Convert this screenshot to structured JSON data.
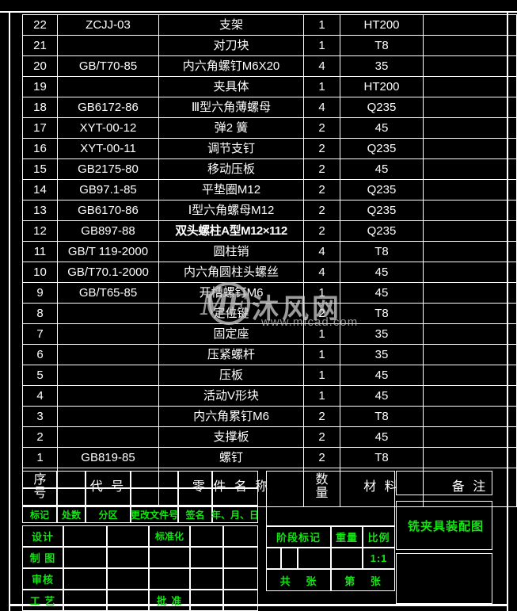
{
  "document": {
    "kind": "cad-assembly-drawing",
    "title": "铣夹具装配图"
  },
  "bom": {
    "columns": {
      "no": "序号",
      "no_line1": "序",
      "no_line2": "号",
      "code": "代    号",
      "name": "零 件 名 称",
      "qty": "数量",
      "qty_line1": "数",
      "qty_line2": "量",
      "material": "材    料",
      "remark": "备    注"
    },
    "rows": [
      {
        "no": "22",
        "code": "ZCJJ-03",
        "name": "支架",
        "qty": "1",
        "material": "HT200",
        "remark": ""
      },
      {
        "no": "21",
        "code": "",
        "name": "对刀块",
        "qty": "1",
        "material": "T8",
        "remark": ""
      },
      {
        "no": "20",
        "code": "GB/T70-85",
        "name": "内六角螺钉M6X20",
        "qty": "4",
        "material": "35",
        "remark": ""
      },
      {
        "no": "19",
        "code": "",
        "name": "夹具体",
        "qty": "1",
        "material": "HT200",
        "remark": ""
      },
      {
        "no": "18",
        "code": "GB6172-86",
        "name": "Ⅲ型六角薄螺母",
        "qty": "4",
        "material": "Q235",
        "remark": ""
      },
      {
        "no": "17",
        "code": "XYT-00-12",
        "name": "弹2 簧",
        "qty": "2",
        "material": "45",
        "remark": ""
      },
      {
        "no": "16",
        "code": "XYT-00-11",
        "name": "调节支钉",
        "qty": "2",
        "material": "Q235",
        "remark": ""
      },
      {
        "no": "15",
        "code": "GB2175-80",
        "name": "移动压板",
        "qty": "2",
        "material": "45",
        "remark": ""
      },
      {
        "no": "14",
        "code": "GB97.1-85",
        "name": "平垫圈M12",
        "qty": "2",
        "material": "Q235",
        "remark": ""
      },
      {
        "no": "13",
        "code": "GB6170-86",
        "name": "Ⅰ型六角螺母M12",
        "qty": "2",
        "material": "Q235",
        "remark": ""
      },
      {
        "no": "12",
        "code": "GB897-88",
        "name": "双头螺柱A型M12×112",
        "qty": "2",
        "material": "Q235",
        "remark": ""
      },
      {
        "no": "11",
        "code": "GB/T 119-2000",
        "name": "圆柱销",
        "qty": "4",
        "material": "T8",
        "remark": ""
      },
      {
        "no": "10",
        "code": "GB/T70.1-2000",
        "name": "内六角圆柱头螺丝",
        "qty": "4",
        "material": "45",
        "remark": ""
      },
      {
        "no": "9",
        "code": "GB/T65-85",
        "name": "开槽螺钉M6",
        "qty": "1",
        "material": "45",
        "remark": ""
      },
      {
        "no": "8",
        "code": "",
        "name": "定位键",
        "qty": "2",
        "material": "T8",
        "remark": ""
      },
      {
        "no": "7",
        "code": "",
        "name": "固定座",
        "qty": "1",
        "material": "35",
        "remark": ""
      },
      {
        "no": "6",
        "code": "",
        "name": "压紧螺杆",
        "qty": "1",
        "material": "35",
        "remark": ""
      },
      {
        "no": "5",
        "code": "",
        "name": "压板",
        "qty": "1",
        "material": "45",
        "remark": ""
      },
      {
        "no": "4",
        "code": "",
        "name": "活动V形块",
        "qty": "1",
        "material": "45",
        "remark": ""
      },
      {
        "no": "3",
        "code": "",
        "name": "内六角累钉M6",
        "qty": "2",
        "material": "T8",
        "remark": ""
      },
      {
        "no": "2",
        "code": "",
        "name": "支撑板",
        "qty": "2",
        "material": "45",
        "remark": ""
      },
      {
        "no": "1",
        "code": "GB819-85",
        "name": "螺钉",
        "qty": "2",
        "material": "T8",
        "remark": ""
      }
    ]
  },
  "title_block": {
    "revision_headers": [
      "标记",
      "处数",
      "分区",
      "更改文件号",
      "签名",
      "年、月、日"
    ],
    "roles": {
      "design": "设计",
      "standardize": "标准化",
      "drawing": "制 图",
      "review": "审核",
      "process": "工 艺",
      "approve": "批 准"
    },
    "stage": {
      "stage_mark": "阶段标记",
      "weight": "重量",
      "scale": "比例",
      "scale_value": "1:1"
    },
    "sheets": {
      "total_prefix": "共",
      "total_suffix": "张",
      "current_prefix": "第",
      "current_suffix": "张"
    },
    "drawing_title": "铣夹具装配图"
  },
  "watermark": {
    "logo": "MF",
    "brand": "沐风网",
    "url": "www.mfcad.com"
  },
  "colors": {
    "background": "#000000",
    "line": "#ffffff",
    "bom_text": "#ffffff",
    "title_block_text": "#14e314"
  }
}
